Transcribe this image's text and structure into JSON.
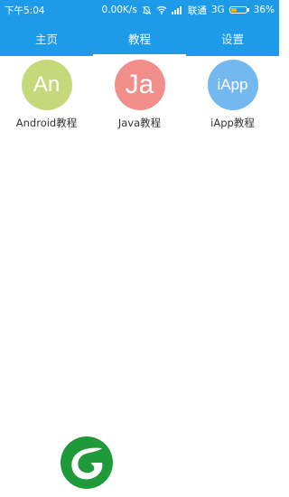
{
  "status_bar": {
    "time": "下午5:04",
    "network_speed": "0.00K/s",
    "carrier": "联通",
    "network_type": "3G",
    "battery": "36%",
    "battery_level": 0.36,
    "battery_fill_color": "#f5b200",
    "icons": [
      "alarm-off-icon",
      "wifi-icon",
      "signal-icon",
      "battery-icon"
    ]
  },
  "tabs": [
    {
      "label": "主页",
      "active": false
    },
    {
      "label": "教程",
      "active": true
    },
    {
      "label": "设置",
      "active": false
    }
  ],
  "courses": [
    {
      "initials": "An",
      "label": "Android教程",
      "color": "#c5d97a"
    },
    {
      "initials": "Ja",
      "label": "Java教程",
      "color": "#f28e89"
    },
    {
      "initials": "iApp",
      "label": "iApp教程",
      "color": "#73b9ef"
    }
  ],
  "colors": {
    "primary": "#1e9be8",
    "logo_green": "#1f9a3a"
  },
  "logo": {
    "icon": "leaf-logo-icon"
  }
}
